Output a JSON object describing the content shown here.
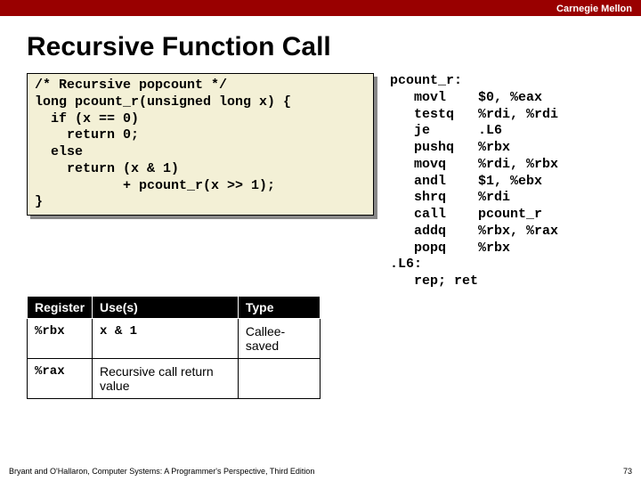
{
  "brand": "Carnegie Mellon",
  "title": "Recursive Function Call",
  "code": "/* Recursive popcount */\nlong pcount_r(unsigned long x) {\n  if (x == 0)\n    return 0;\n  else\n    return (x & 1)\n           + pcount_r(x >> 1);\n}",
  "asm": "pcount_r:\n   movl    $0, %eax\n   testq   %rdi, %rdi\n   je      .L6\n   pushq   %rbx\n   movq    %rdi, %rbx\n   andl    $1, %ebx\n   shrq    %rdi\n   call    pcount_r\n   addq    %rbx, %rax\n   popq    %rbx\n.L6:\n   rep; ret",
  "table": {
    "headers": [
      "Register",
      "Use(s)",
      "Type"
    ],
    "rows": [
      {
        "reg": "%rbx",
        "use": "x & 1",
        "type": "Callee-saved"
      },
      {
        "reg": "%rax",
        "use": "Recursive call return value",
        "type": ""
      }
    ]
  },
  "footer_left": "Bryant and O'Hallaron, Computer Systems: A Programmer's Perspective, Third Edition",
  "footer_right": "73"
}
